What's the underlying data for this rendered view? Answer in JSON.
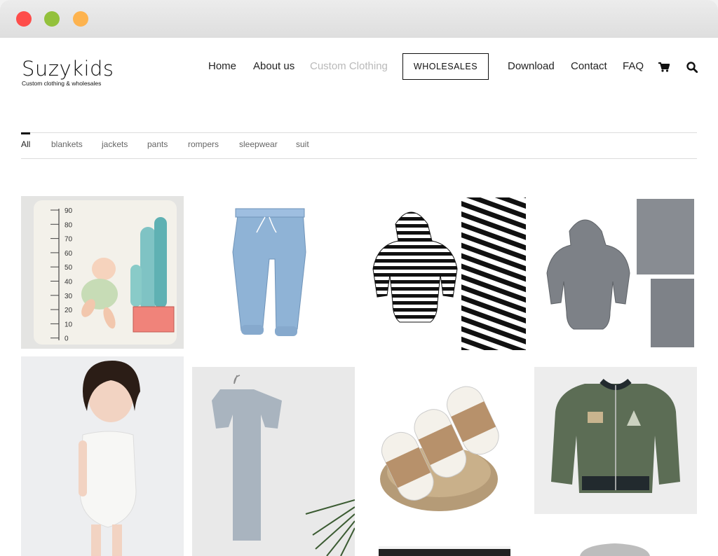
{
  "window": {
    "controls": [
      "close",
      "minimize",
      "maximize"
    ]
  },
  "brand": {
    "name": "Suzykids",
    "tagline": "Custom clothing & wholesales"
  },
  "nav": {
    "home": "Home",
    "about": "About us",
    "custom": "Custom Clothing",
    "wholesales": "WHOLESALES",
    "download": "Download",
    "contact": "Contact",
    "faq": "FAQ",
    "cart_icon": "cart-icon",
    "search_icon": "search-icon"
  },
  "filters": {
    "all": "All",
    "blankets": "blankets",
    "jackets": "jackets",
    "pants": "pants",
    "rompers": "rompers",
    "sleepwear": "sleepwear",
    "suit": "suit"
  },
  "blanket_scale": [
    "90",
    "80",
    "70",
    "60",
    "50",
    "40",
    "30",
    "20",
    "10",
    "0"
  ],
  "colors": {
    "active_nav": "#b9b9b9",
    "text": "#222222",
    "accent_border": "#111111"
  }
}
